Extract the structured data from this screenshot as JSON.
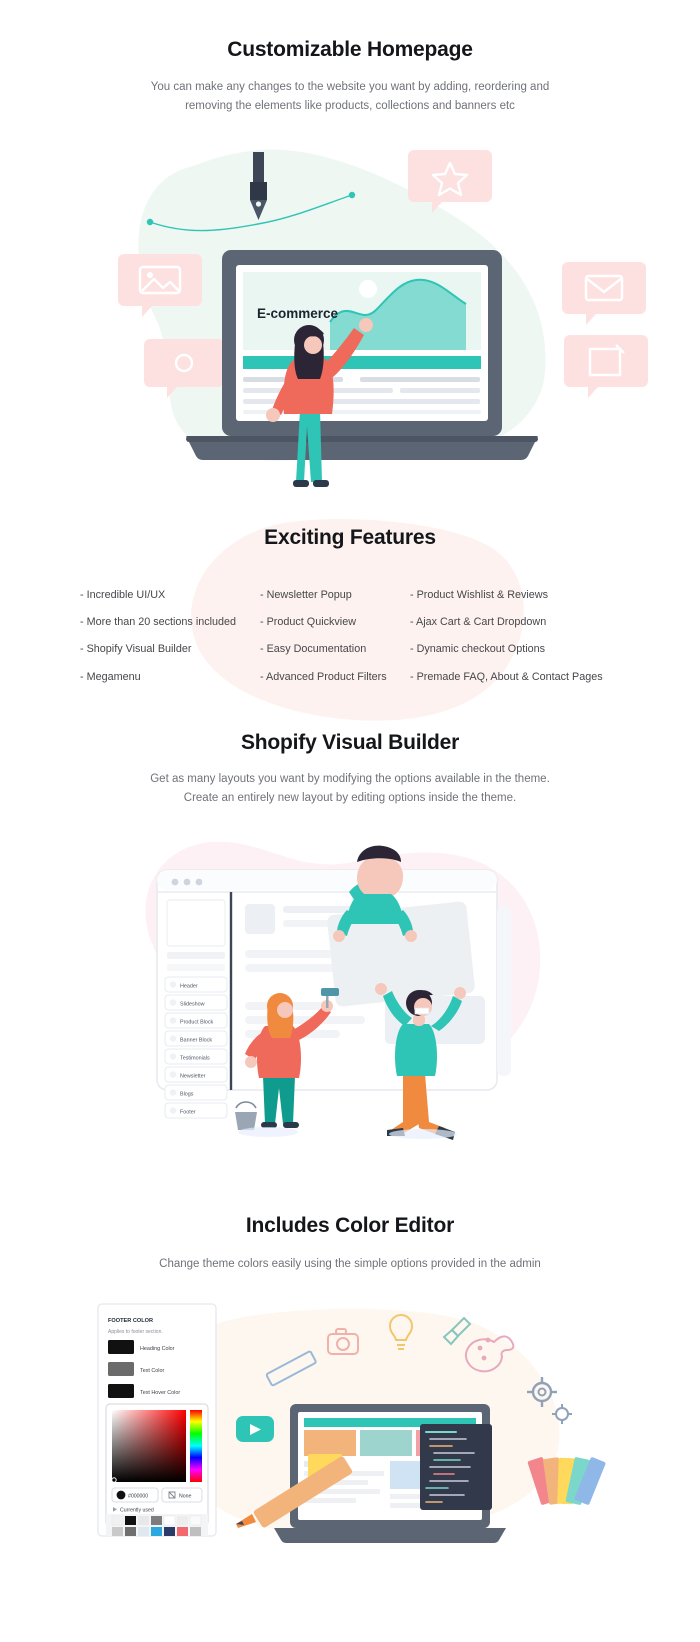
{
  "sections": {
    "homepage": {
      "title": "Customizable Homepage",
      "subtitle": "You can make any changes to the website you want by adding, reordering and removing the elements like products, collections and banners etc",
      "illustration": {
        "screen_label": "E-commerce",
        "name": "woman-presenting-laptop-ecommerce"
      }
    },
    "features": {
      "title": "Exciting Features",
      "items": [
        "- Incredible UI/UX",
        "- Newsletter Popup",
        "- Product Wishlist & Reviews",
        "- More than 20 sections included",
        "- Product Quickview",
        "- Ajax Cart & Cart Dropdown",
        "- Shopify Visual Builder",
        "- Easy Documentation",
        "- Dynamic checkout Options",
        "- Megamenu",
        "- Advanced Product Filters",
        "- Premade FAQ, About & Contact Pages"
      ]
    },
    "builder": {
      "title": "Shopify Visual Builder",
      "subtitle_line1": "Get as many layouts you want by modifying the options available in the theme.",
      "subtitle_line2": "Create an entirely new layout by editing options inside the theme.",
      "sidebar_sections": [
        "Header",
        "Slideshow",
        "Product Block",
        "Banner Block",
        "Testimonials",
        "Newsletter",
        "Blogs",
        "Footer"
      ]
    },
    "color_editor": {
      "title": "Includes Color Editor",
      "subtitle": "Change theme colors easily using the simple options provided in the admin",
      "panel": {
        "group_title": "FOOTER COLOR",
        "group_note": "Applies to footer section.",
        "rows": [
          {
            "label": "Heading Color",
            "swatch": "#111111"
          },
          {
            "label": "Text Color",
            "swatch": "#6b6b6b"
          },
          {
            "label": "Text Hover Color",
            "swatch": "#111111"
          }
        ],
        "hex_value": "#000000",
        "none_label": "None",
        "currently_used_label": "Currently used",
        "recent_swatches_row1": [
          "#f1f1f1",
          "#111111",
          "#e8e8e8",
          "#7d7d7d",
          "#ffffff",
          "#ededed",
          "#fafafa"
        ],
        "recent_swatches_row2": [
          "#c9c9c9",
          "#6f6f6f",
          "#dfe7ef",
          "#2aa8e0",
          "#2b3a66",
          "#f2686d",
          "#bfbfbf"
        ]
      }
    }
  },
  "palette": {
    "heading": "#15161a",
    "body_text": "#6f7278",
    "feature_text": "#46474b",
    "teal": "#2ec4b6",
    "coral": "#ef6a5a",
    "pink_blob": "#fdf0ef",
    "mint_blob": "#eef7f2",
    "page_bg": "#ffffff",
    "laptop_gray": "#5c6574"
  }
}
